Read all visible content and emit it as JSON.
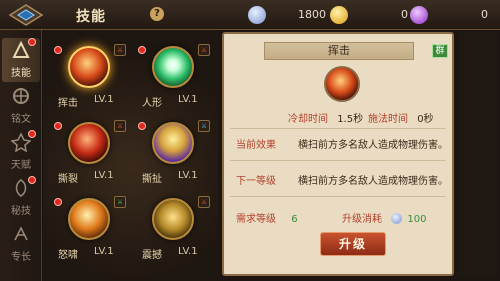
{
  "header": {
    "title": "技能",
    "help": "?",
    "resources": [
      {
        "name": "diamond",
        "value": "1800",
        "color": "#9ab3ff"
      },
      {
        "name": "gold",
        "value": "0",
        "color": "#f0c12b"
      },
      {
        "name": "purple-gem",
        "value": "0",
        "color": "#b44ce0"
      }
    ]
  },
  "sidebar": {
    "items": [
      {
        "label": "技能",
        "icon": "skill-icon",
        "active": true
      },
      {
        "label": "铭文",
        "icon": "inscription-icon",
        "active": false
      },
      {
        "label": "天赋",
        "icon": "talent-icon",
        "active": false
      },
      {
        "label": "秘技",
        "icon": "secret-skill-icon",
        "active": false
      },
      {
        "label": "专长",
        "icon": "specialty-icon",
        "active": false
      }
    ]
  },
  "skills": [
    {
      "name": "挥击",
      "level": "LV.1",
      "color": "#d84a1a",
      "badge": "⚔"
    },
    {
      "name": "人形",
      "level": "LV.1",
      "color": "#2fbf6a",
      "badge": "⚔"
    },
    {
      "name": "撕裂",
      "level": "LV.1",
      "color": "#c52b15",
      "badge": "⚔"
    },
    {
      "name": "撕扯",
      "level": "LV.1",
      "color": "#d6a23a",
      "badge": "⚔"
    },
    {
      "name": "怒啸",
      "level": "LV.1",
      "color": "#e07a1a",
      "badge": "⚔"
    },
    {
      "name": "震撼",
      "level": "LV.1",
      "color": "#b58a28",
      "badge": "⚔"
    }
  ],
  "detail": {
    "title": "挥击",
    "tag": "群",
    "cooldown_label": "冷却时间",
    "cooldown_value": "1.5秒",
    "cast_label": "施法时间",
    "cast_value": "0秒",
    "current_label": "当前效果",
    "current_text": "横扫前方多名敌人造成物理伤害。",
    "next_label": "下一等级",
    "next_text": "横扫前方多名敌人造成物理伤害。",
    "req_label": "需求等级",
    "req_value": "6",
    "cost_label": "升级消耗",
    "cost_value": "100",
    "upgrade_label": "升级"
  }
}
